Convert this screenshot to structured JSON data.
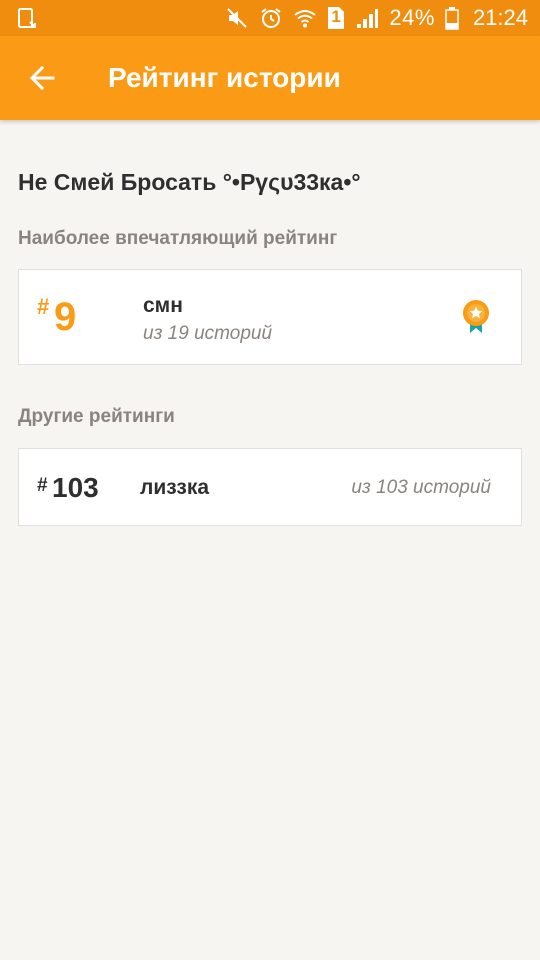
{
  "status_bar": {
    "battery": "24%",
    "time": "21:24",
    "sim_label": "1",
    "icons": [
      "screenshot-icon",
      "mute-icon",
      "alarm-icon",
      "wifi-icon",
      "sim-icon",
      "signal-icon",
      "battery-icon"
    ]
  },
  "app_bar": {
    "title": "Рейтинг истории",
    "back_icon": "arrow-left-icon",
    "color": "#fb9a14"
  },
  "story": {
    "title": "Не Смей Бросать °•Рγςυ33ка•°"
  },
  "top_section": {
    "label": "Наиболее впечатляющий рейтинг",
    "hash": "#",
    "rank": "9",
    "tag": "смн",
    "sub": "из 19 историй",
    "icon": "medal-icon",
    "accent": "#fb9a14"
  },
  "other_section": {
    "label": "Другие рейтинги",
    "items": [
      {
        "hash": "#",
        "rank": "103",
        "tag": "лиззка",
        "sub": "из 103 историй"
      }
    ]
  }
}
